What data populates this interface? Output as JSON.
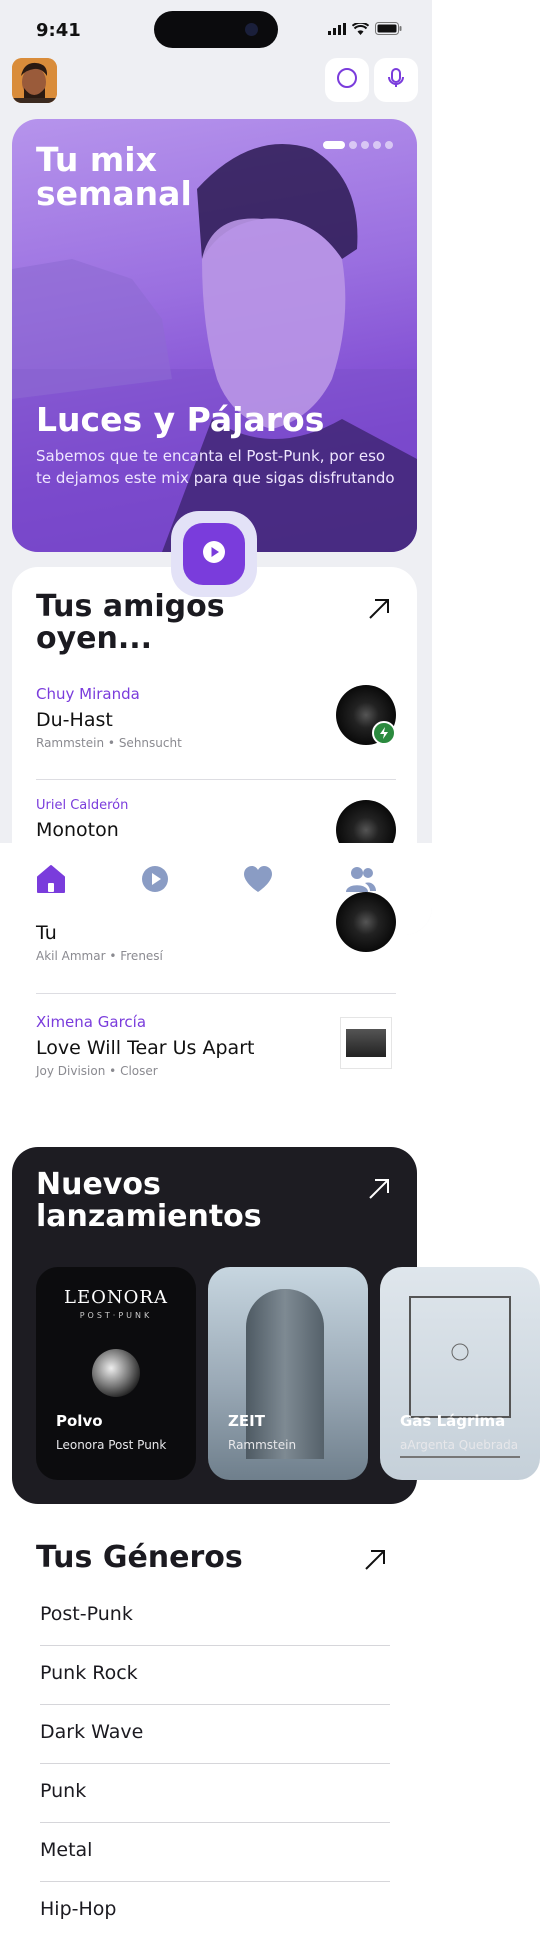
{
  "status_bar": {
    "time": "9:41"
  },
  "hero": {
    "label": "Tu mix semanal",
    "title": "Luces y Pájaros",
    "description": "Sabemos que te encanta el Post-Punk, por eso te dejamos este mix para que sigas disfrutando",
    "page_count": 5,
    "active_page": 1
  },
  "friends": {
    "title": "Tus amigos oyen...",
    "items": [
      {
        "name": "Chuy Miranda",
        "song": "Du-Hast",
        "artist": "Rammstein",
        "album": "Sehnsucht"
      },
      {
        "name": "Uriel Calderón",
        "song": "Monoton",
        "artist": "",
        "album": ""
      },
      {
        "name": "",
        "song": "Tu",
        "artist": "Akil Ammar",
        "album": "Frenesí"
      },
      {
        "name": "Ximena García",
        "song": "Love Will Tear Us Apart",
        "artist": "Joy Division",
        "album": "Closer"
      }
    ]
  },
  "releases": {
    "title": "Nuevos lanzamientos",
    "items": [
      {
        "title": "Polvo",
        "artist": "Leonora Post Punk",
        "art_text": "LEONORA",
        "art_sub": "POST·PUNK"
      },
      {
        "title": "ZEIT",
        "artist": "Rammstein"
      },
      {
        "title": "Gas Lágrima",
        "artist": "aArgenta Quebrada"
      }
    ]
  },
  "genres": {
    "title": "Tus Géneros",
    "items": [
      "Post-Punk",
      "Punk Rock",
      "Dark Wave",
      "Punk",
      "Metal",
      "Hip-Hop"
    ]
  },
  "colors": {
    "accent": "#7a3cdc",
    "nav_icon": "#8a9cc4",
    "dark_card": "#1d1c22"
  },
  "icons": {
    "search": "circle-search-icon",
    "mic": "microphone-icon",
    "nav": [
      "home-icon",
      "play-icon",
      "heart-icon",
      "users-icon"
    ]
  }
}
